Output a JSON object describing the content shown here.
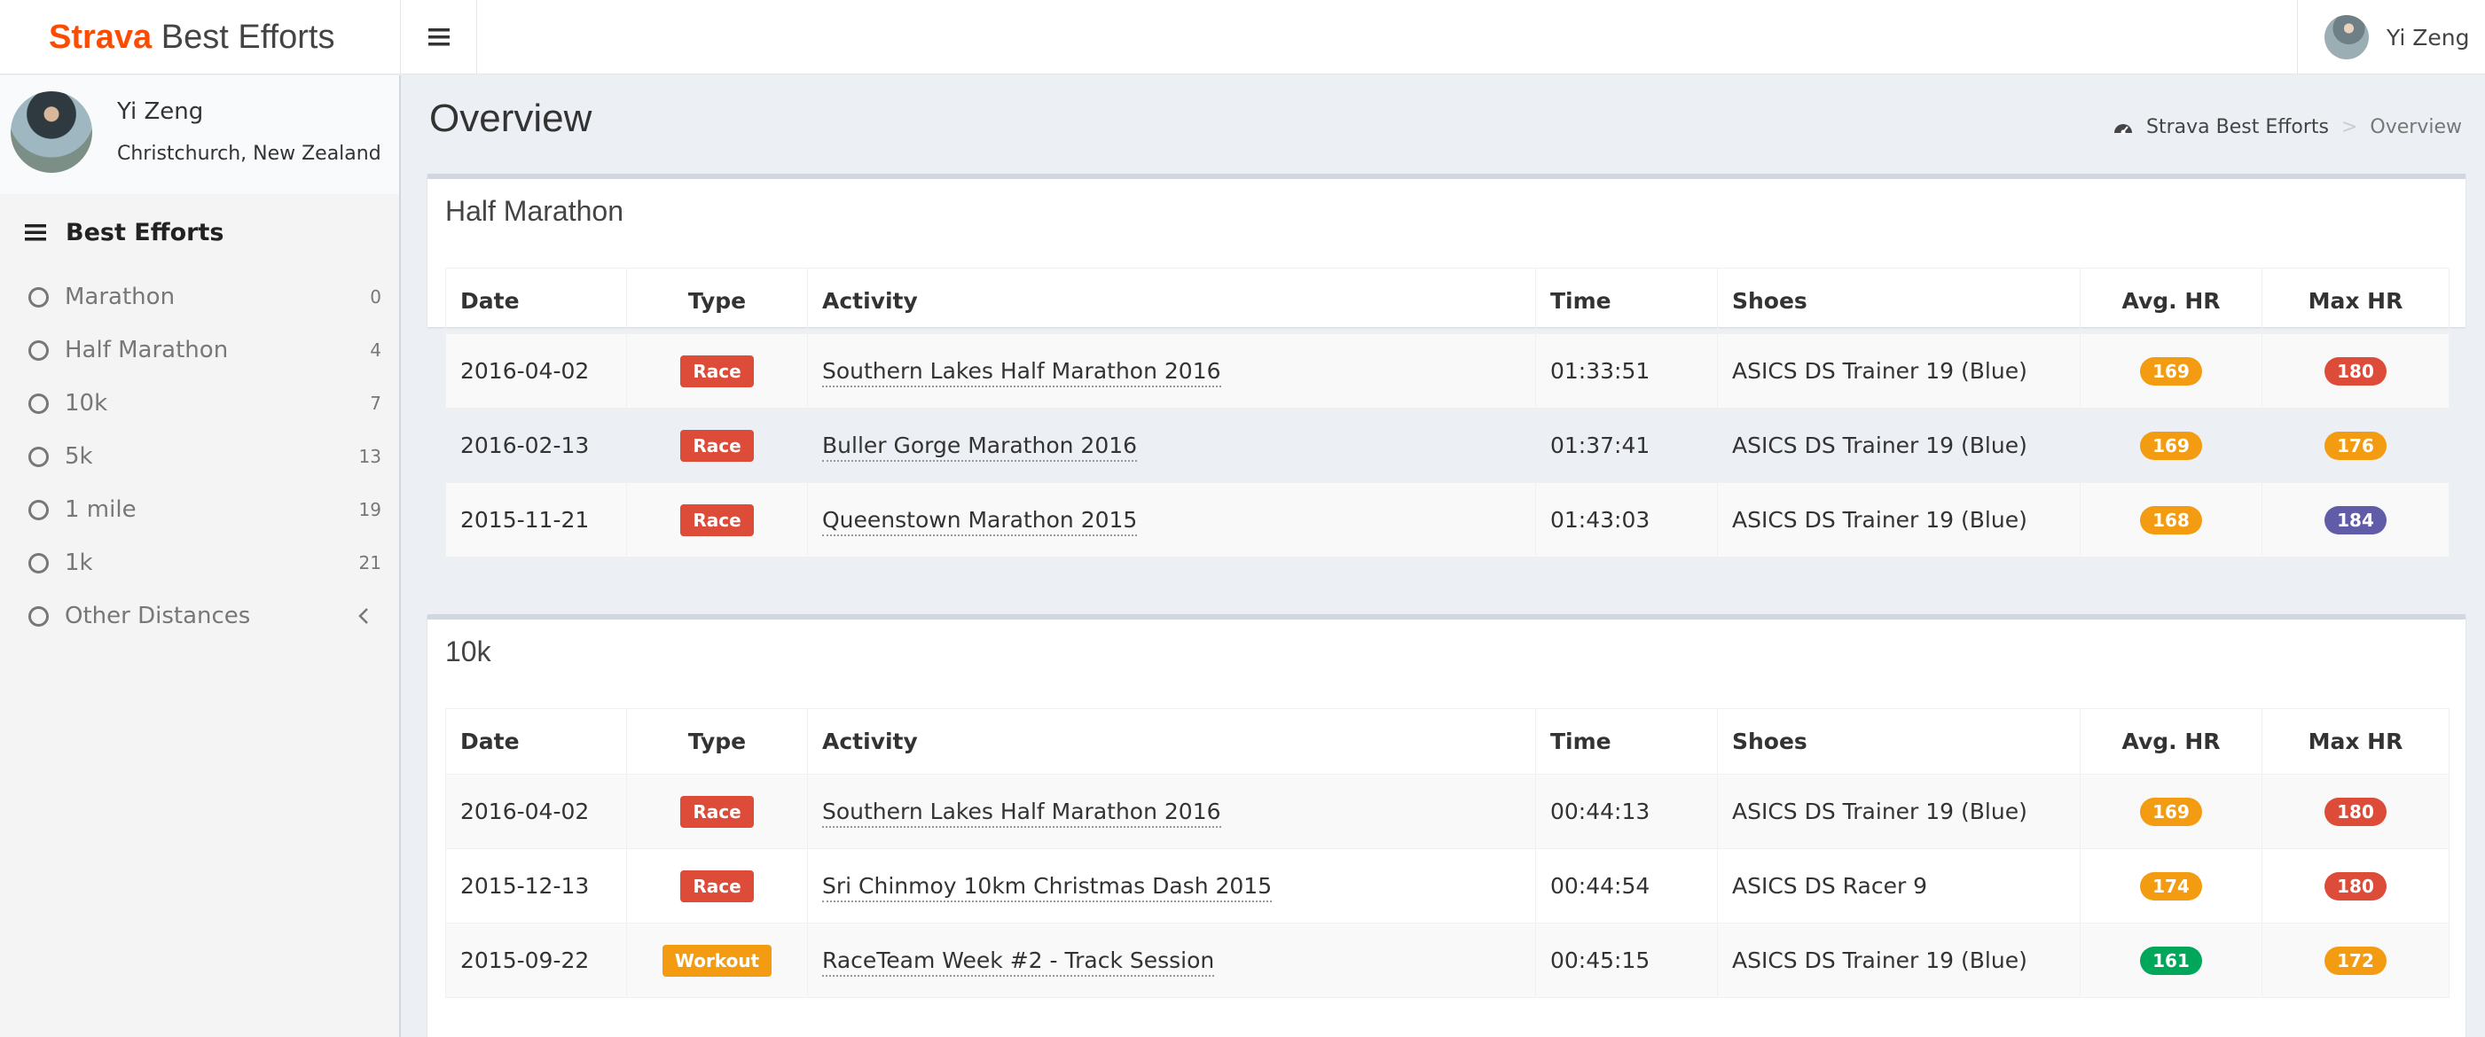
{
  "header": {
    "brand": "Strava",
    "title_rest": " Best Efforts",
    "user_name": "Yi Zeng"
  },
  "sidebar": {
    "user": {
      "name": "Yi Zeng",
      "location": "Christchurch, New Zealand"
    },
    "menu_header": "Best Efforts",
    "items": [
      {
        "label": "Marathon",
        "count": "0"
      },
      {
        "label": "Half Marathon",
        "count": "4"
      },
      {
        "label": "10k",
        "count": "7"
      },
      {
        "label": "5k",
        "count": "13"
      },
      {
        "label": "1 mile",
        "count": "19"
      },
      {
        "label": "1k",
        "count": "21"
      }
    ],
    "other": "Other Distances"
  },
  "page": {
    "title": "Overview",
    "breadcrumb_home": "Strava Best Efforts",
    "breadcrumb_sep": ">",
    "breadcrumb_current": "Overview"
  },
  "columns": [
    "Date",
    "Type",
    "Activity",
    "Time",
    "Shoes",
    "Avg. HR",
    "Max HR"
  ],
  "sections": [
    {
      "title": "Half Marathon",
      "rows": [
        {
          "date": "2016-04-02",
          "type": "Race",
          "type_color": "#dd4b39",
          "activity": "Southern Lakes Half Marathon 2016",
          "time": "01:33:51",
          "shoes": "ASICS DS Trainer 19 (Blue)",
          "avg_hr": "169",
          "avg_hr_color": "#f39c12",
          "max_hr": "180",
          "max_hr_color": "#dd4b39"
        },
        {
          "date": "2016-02-13",
          "type": "Race",
          "type_color": "#dd4b39",
          "activity": "Buller Gorge Marathon 2016",
          "time": "01:37:41",
          "shoes": "ASICS DS Trainer 19 (Blue)",
          "avg_hr": "169",
          "avg_hr_color": "#f39c12",
          "max_hr": "176",
          "max_hr_color": "#f39c12"
        },
        {
          "date": "2015-11-21",
          "type": "Race",
          "type_color": "#dd4b39",
          "activity": "Queenstown Marathon 2015",
          "time": "01:43:03",
          "shoes": "ASICS DS Trainer 19 (Blue)",
          "avg_hr": "168",
          "avg_hr_color": "#f39c12",
          "max_hr": "184",
          "max_hr_color": "#605ca8"
        }
      ]
    },
    {
      "title": "10k",
      "rows": [
        {
          "date": "2016-04-02",
          "type": "Race",
          "type_color": "#dd4b39",
          "activity": "Southern Lakes Half Marathon 2016",
          "time": "00:44:13",
          "shoes": "ASICS DS Trainer 19 (Blue)",
          "avg_hr": "169",
          "avg_hr_color": "#f39c12",
          "max_hr": "180",
          "max_hr_color": "#dd4b39"
        },
        {
          "date": "2015-12-13",
          "type": "Race",
          "type_color": "#dd4b39",
          "activity": "Sri Chinmoy 10km Christmas Dash 2015",
          "time": "00:44:54",
          "shoes": "ASICS DS Racer 9",
          "avg_hr": "174",
          "avg_hr_color": "#f39c12",
          "max_hr": "180",
          "max_hr_color": "#dd4b39"
        },
        {
          "date": "2015-09-22",
          "type": "Workout",
          "type_color": "#f39c12",
          "activity": "RaceTeam Week #2 - Track Session",
          "time": "00:45:15",
          "shoes": "ASICS DS Trainer 19 (Blue)",
          "avg_hr": "161",
          "avg_hr_color": "#00a65a",
          "max_hr": "172",
          "max_hr_color": "#f39c12"
        }
      ]
    }
  ]
}
